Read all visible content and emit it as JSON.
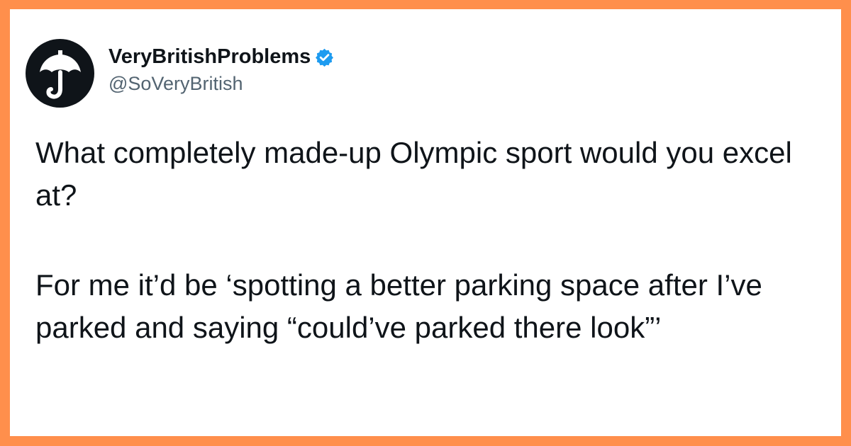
{
  "colors": {
    "frame": "#FF8F4C",
    "card": "#FFFFFF",
    "text": "#0F1419",
    "handle": "#536471",
    "verified": "#1D9BF0"
  },
  "author": {
    "display_name": "VeryBritishProblems",
    "handle": "@SoVeryBritish",
    "avatar_icon": "umbrella-icon",
    "verified_icon": "verified-badge-icon"
  },
  "tweet": {
    "paragraph_1": "What completely made-up Olympic sport would you excel at?",
    "paragraph_2": "For me it’d be ‘spotting a better parking space after I’ve parked and saying “could’ve parked there look”’"
  }
}
